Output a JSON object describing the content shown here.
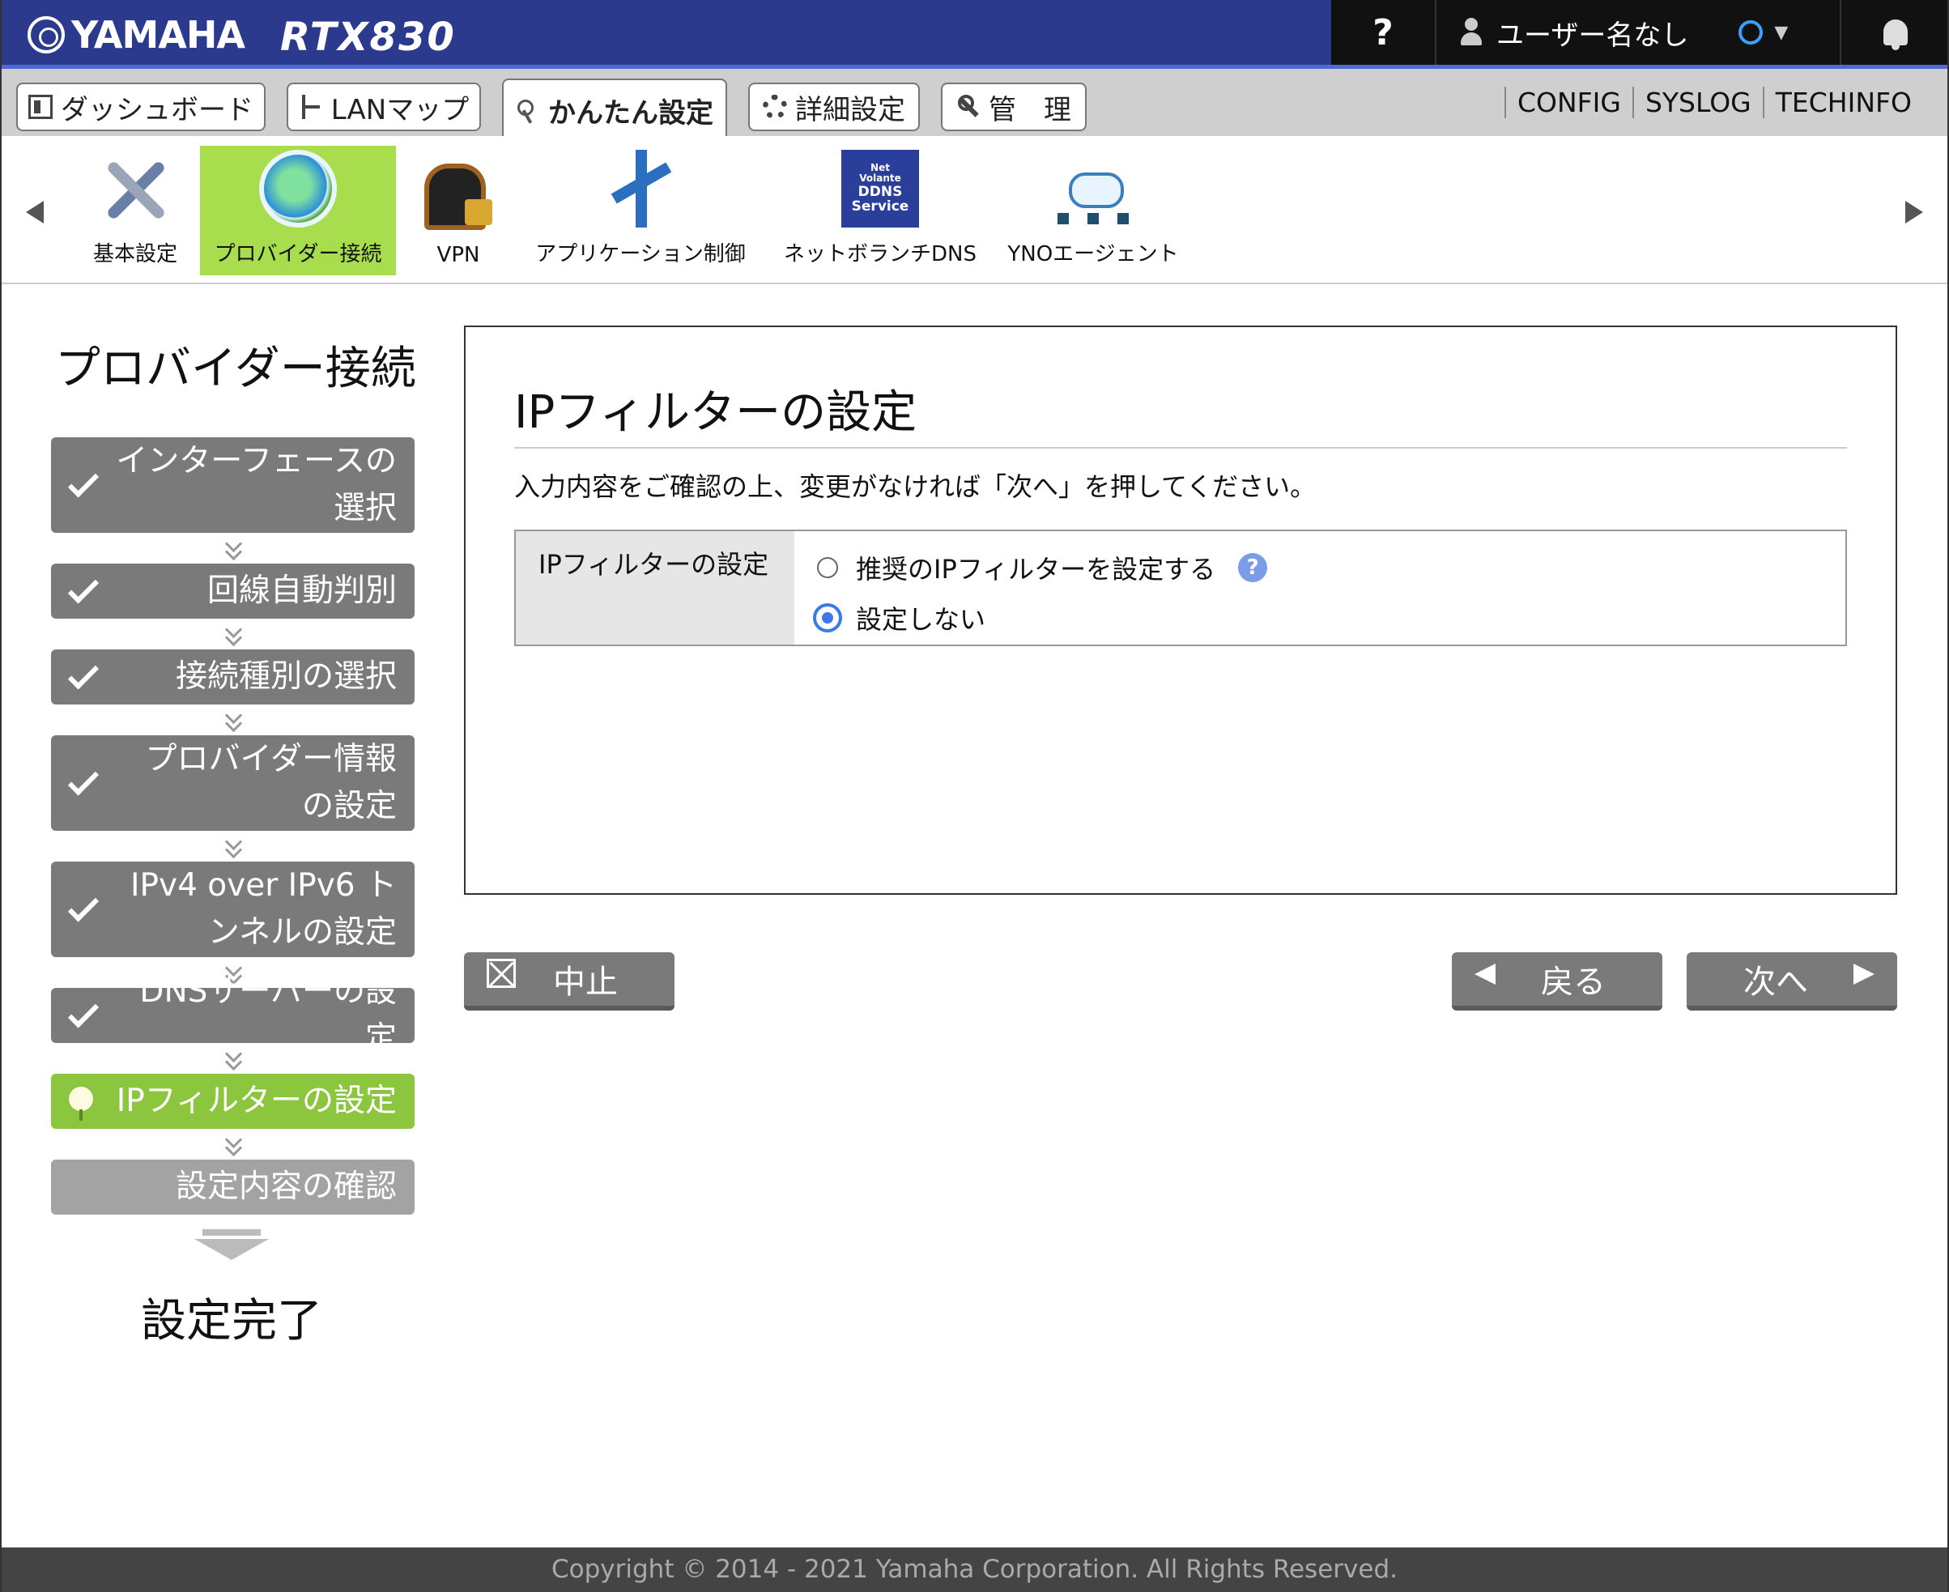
{
  "header": {
    "brand": "YAMAHA",
    "model": "RTX830",
    "help_label": "?",
    "user_name": "ユーザー名なし"
  },
  "tabs": [
    {
      "label": "ダッシュボード",
      "icon": "dashboard-icon"
    },
    {
      "label": "LANマップ",
      "icon": "lan-map-icon"
    },
    {
      "label": "かんたん設定",
      "icon": "wand-icon",
      "active": true
    },
    {
      "label": "詳細設定",
      "icon": "gear-icon"
    },
    {
      "label": "管　理",
      "icon": "wrench-icon"
    }
  ],
  "top_links": [
    "CONFIG",
    "SYSLOG",
    "TECHINFO"
  ],
  "icon_menu": [
    {
      "label": "基本設定",
      "icon": "tools-icon"
    },
    {
      "label": "プロバイダー接続",
      "icon": "globe-icon",
      "active": true
    },
    {
      "label": "VPN",
      "icon": "vpn-lock-icon"
    },
    {
      "label": "アプリケーション制御",
      "icon": "app-control-icon"
    },
    {
      "label": "ネットボランチDNS",
      "icon": "ddns-icon",
      "badge_lines": [
        "Net",
        "Volante",
        "DDNS",
        "Service"
      ]
    },
    {
      "label": "YNOエージェント",
      "icon": "network-cloud-icon"
    }
  ],
  "sidebar": {
    "title": "プロバイダー接続",
    "steps": [
      {
        "label": "インターフェースの選択",
        "status": "done"
      },
      {
        "label": "回線自動判別",
        "status": "done"
      },
      {
        "label": "接続種別の選択",
        "status": "done"
      },
      {
        "label": "プロバイダー情報の設定",
        "status": "done"
      },
      {
        "label": "IPv4 over IPv6 トンネルの設定",
        "status": "done"
      },
      {
        "label": "DNSサーバーの設定",
        "status": "done"
      },
      {
        "label": "IPフィルターの設定",
        "status": "current"
      },
      {
        "label": "設定内容の確認",
        "status": "pending"
      }
    ],
    "done_label": "設定完了"
  },
  "main": {
    "title": "IPフィルターの設定",
    "description": "入力内容をご確認の上、変更がなければ「次へ」を押してください。",
    "field_label": "IPフィルターの設定",
    "options": [
      {
        "label": "推奨のIPフィルターを設定する",
        "selected": false
      },
      {
        "label": "設定しない",
        "selected": true
      }
    ]
  },
  "buttons": {
    "cancel": "中止",
    "back": "戻る",
    "next": "次へ"
  },
  "footer": {
    "copyright": "Copyright © 2014 - 2021 Yamaha Corporation. All Rights Reserved."
  },
  "colors": {
    "header_bg": "#2b3a8c",
    "accent_green": "#8cc63f",
    "step_done": "#7a7a7a",
    "step_pending": "#a3a3a3",
    "radio_blue": "#3a7be8"
  }
}
